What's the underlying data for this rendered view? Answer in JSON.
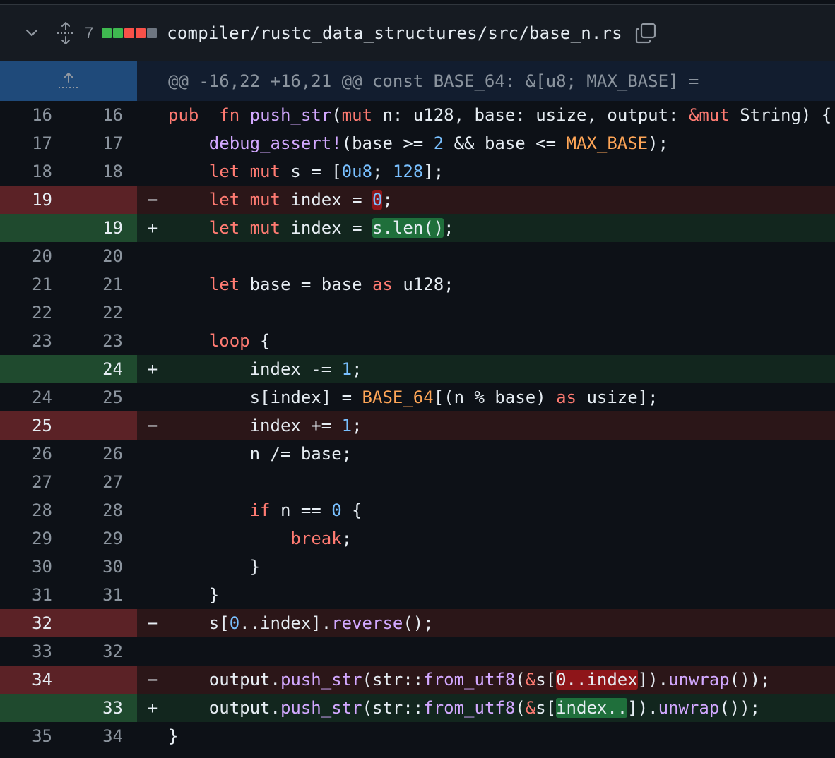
{
  "header": {
    "changes_count": "7",
    "file_path": "compiler/rustc_data_structures/src/base_n.rs",
    "diffstat": [
      "#3fb950",
      "#3fb950",
      "#f85149",
      "#f85149",
      "#6e7681"
    ]
  },
  "hunk": {
    "text": "@@ -16,22 +16,21 @@ const BASE_64: &[u8; MAX_BASE] ="
  },
  "lines": [
    {
      "old": "16",
      "new": "16",
      "type": "ctx",
      "indent": 0,
      "segs": [
        [
          "kw",
          "pub"
        ],
        [
          "",
          "  "
        ],
        [
          "kw",
          "fn"
        ],
        [
          "",
          " "
        ],
        [
          "fn",
          "push_str"
        ],
        [
          "",
          "("
        ],
        [
          "kw",
          "mut"
        ],
        [
          "",
          " n: u128, base: usize, output: "
        ],
        [
          "kw",
          "&mut"
        ],
        [
          "",
          " String) {"
        ]
      ]
    },
    {
      "old": "17",
      "new": "17",
      "type": "ctx",
      "indent": 1,
      "segs": [
        [
          "fn",
          "debug_assert!"
        ],
        [
          "",
          "(base >= "
        ],
        [
          "num",
          "2"
        ],
        [
          "",
          " && base <= "
        ],
        [
          "const",
          "MAX_BASE"
        ],
        [
          "",
          ");"
        ]
      ]
    },
    {
      "old": "18",
      "new": "18",
      "type": "ctx",
      "indent": 1,
      "segs": [
        [
          "kw",
          "let"
        ],
        [
          "",
          " "
        ],
        [
          "kw",
          "mut"
        ],
        [
          "",
          " s = ["
        ],
        [
          "num",
          "0u8"
        ],
        [
          "",
          "; "
        ],
        [
          "num",
          "128"
        ],
        [
          "",
          "];"
        ]
      ]
    },
    {
      "old": "19",
      "new": "",
      "type": "del",
      "indent": 1,
      "segs": [
        [
          "kw",
          "let"
        ],
        [
          "",
          " "
        ],
        [
          "kw",
          "mut"
        ],
        [
          "",
          " index = "
        ],
        [
          "hl-del num",
          "0"
        ],
        [
          "",
          ";"
        ]
      ]
    },
    {
      "old": "",
      "new": "19",
      "type": "add",
      "indent": 1,
      "segs": [
        [
          "kw",
          "let"
        ],
        [
          "",
          " "
        ],
        [
          "kw",
          "mut"
        ],
        [
          "",
          " index = "
        ],
        [
          "hl-add",
          "s.len()"
        ],
        [
          "",
          ";"
        ]
      ]
    },
    {
      "old": "20",
      "new": "20",
      "type": "ctx",
      "indent": 1,
      "segs": []
    },
    {
      "old": "21",
      "new": "21",
      "type": "ctx",
      "indent": 1,
      "segs": [
        [
          "kw",
          "let"
        ],
        [
          "",
          " base = base "
        ],
        [
          "kw",
          "as"
        ],
        [
          "",
          " u128;"
        ]
      ]
    },
    {
      "old": "22",
      "new": "22",
      "type": "ctx",
      "indent": 1,
      "segs": []
    },
    {
      "old": "23",
      "new": "23",
      "type": "ctx",
      "indent": 1,
      "segs": [
        [
          "kw",
          "loop"
        ],
        [
          "",
          " {"
        ]
      ]
    },
    {
      "old": "",
      "new": "24",
      "type": "add",
      "indent": 2,
      "segs": [
        [
          "",
          "index -= "
        ],
        [
          "num",
          "1"
        ],
        [
          "",
          ";"
        ]
      ]
    },
    {
      "old": "24",
      "new": "25",
      "type": "ctx",
      "indent": 2,
      "segs": [
        [
          "",
          "s[index] = "
        ],
        [
          "const",
          "BASE_64"
        ],
        [
          "",
          "[(n % base) "
        ],
        [
          "kw",
          "as"
        ],
        [
          "",
          " usize];"
        ]
      ]
    },
    {
      "old": "25",
      "new": "",
      "type": "del",
      "indent": 2,
      "segs": [
        [
          "",
          "index += "
        ],
        [
          "num",
          "1"
        ],
        [
          "",
          ";"
        ]
      ]
    },
    {
      "old": "26",
      "new": "26",
      "type": "ctx",
      "indent": 2,
      "segs": [
        [
          "",
          "n /= base;"
        ]
      ]
    },
    {
      "old": "27",
      "new": "27",
      "type": "ctx",
      "indent": 2,
      "segs": []
    },
    {
      "old": "28",
      "new": "28",
      "type": "ctx",
      "indent": 2,
      "segs": [
        [
          "kw",
          "if"
        ],
        [
          "",
          " n == "
        ],
        [
          "num",
          "0"
        ],
        [
          "",
          " {"
        ]
      ]
    },
    {
      "old": "29",
      "new": "29",
      "type": "ctx",
      "indent": 3,
      "segs": [
        [
          "kw",
          "break"
        ],
        [
          "",
          ";"
        ]
      ]
    },
    {
      "old": "30",
      "new": "30",
      "type": "ctx",
      "indent": 2,
      "segs": [
        [
          "",
          "}"
        ]
      ]
    },
    {
      "old": "31",
      "new": "31",
      "type": "ctx",
      "indent": 1,
      "segs": [
        [
          "",
          "}"
        ]
      ]
    },
    {
      "old": "32",
      "new": "",
      "type": "del",
      "indent": 1,
      "segs": [
        [
          "",
          "s["
        ],
        [
          "num",
          "0"
        ],
        [
          "",
          "..index]."
        ],
        [
          "fn",
          "reverse"
        ],
        [
          "",
          "();"
        ]
      ]
    },
    {
      "old": "33",
      "new": "32",
      "type": "ctx",
      "indent": 1,
      "segs": []
    },
    {
      "old": "34",
      "new": "",
      "type": "del",
      "indent": 1,
      "segs": [
        [
          "",
          "output."
        ],
        [
          "fn",
          "push_str"
        ],
        [
          "",
          "(str::"
        ],
        [
          "fn",
          "from_utf8"
        ],
        [
          "",
          "("
        ],
        [
          "kw",
          "&"
        ],
        [
          "",
          "s["
        ],
        [
          "hl-del",
          "0..index"
        ],
        [
          "",
          "])."
        ],
        [
          "fn",
          "unwrap"
        ],
        [
          "",
          "());"
        ]
      ]
    },
    {
      "old": "",
      "new": "33",
      "type": "add",
      "indent": 1,
      "segs": [
        [
          "",
          "output."
        ],
        [
          "fn",
          "push_str"
        ],
        [
          "",
          "(str::"
        ],
        [
          "fn",
          "from_utf8"
        ],
        [
          "",
          "("
        ],
        [
          "kw",
          "&"
        ],
        [
          "",
          "s["
        ],
        [
          "hl-add",
          "index.."
        ],
        [
          "",
          "])."
        ],
        [
          "fn",
          "unwrap"
        ],
        [
          "",
          "());"
        ]
      ]
    },
    {
      "old": "35",
      "new": "34",
      "type": "ctx",
      "indent": 0,
      "segs": [
        [
          "",
          "}"
        ]
      ]
    }
  ]
}
